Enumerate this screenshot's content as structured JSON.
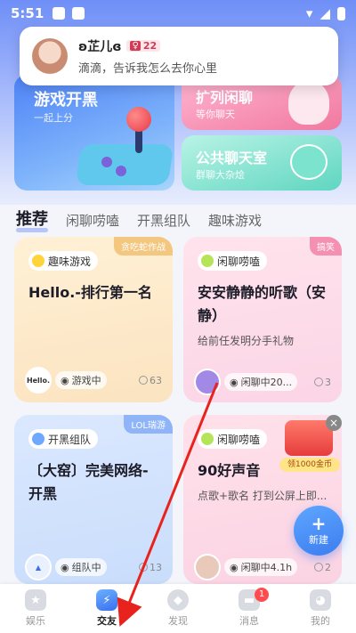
{
  "status_bar": {
    "time": "5:51"
  },
  "notification": {
    "name": "ʚ芷儿ɞ",
    "level": "22",
    "message": "滴滴，告诉我怎么去你心里"
  },
  "banners": {
    "game": {
      "title": "游戏开黑",
      "subtitle": "一起上分"
    },
    "chat": {
      "title": "扩列闲聊",
      "subtitle": "等你聊天"
    },
    "room": {
      "title": "公共聊天室",
      "subtitle": "群聊大杂烩"
    }
  },
  "tabs": [
    "推荐",
    "闲聊唠嗑",
    "开黑组队",
    "趣味游戏"
  ],
  "rooms": [
    {
      "tag": "趣味游戏",
      "corner": "贪吃蛇作战",
      "title": "Hello.-排行第一名",
      "desc": "",
      "host_label": "Hello.",
      "status": "游戏中",
      "count": "63"
    },
    {
      "tag": "闲聊唠嗑",
      "corner": "搞笑",
      "title": "安安静静的听歌（安静）",
      "desc": "给前任发明分手礼物",
      "host_label": "",
      "status": "闲聊中20...",
      "count": "3"
    },
    {
      "tag": "开黑组队",
      "corner": "LOL瑞游",
      "title": "〔大窑〕完美网络-开黑",
      "desc": "",
      "host_label": "",
      "status": "组队中",
      "count": "13"
    },
    {
      "tag": "闲聊唠嗑",
      "corner": "",
      "title": "90好声音",
      "desc": "点歌+歌名 打到公屏上即...",
      "host_label": "",
      "status": "闲聊中4.1h",
      "count": "2"
    }
  ],
  "gift": {
    "label": "领1000金币",
    "close": "×"
  },
  "fab": {
    "label": "新建",
    "plus": "+"
  },
  "bottom_nav": [
    {
      "label": "娱乐",
      "active": false,
      "badge": ""
    },
    {
      "label": "交友",
      "active": true,
      "badge": ""
    },
    {
      "label": "发现",
      "active": false,
      "badge": ""
    },
    {
      "label": "消息",
      "active": false,
      "badge": "1"
    },
    {
      "label": "我的",
      "active": false,
      "badge": ""
    }
  ],
  "colors": {
    "accent": "#3b6ef0",
    "annotation_arrow": "#e8221c"
  }
}
